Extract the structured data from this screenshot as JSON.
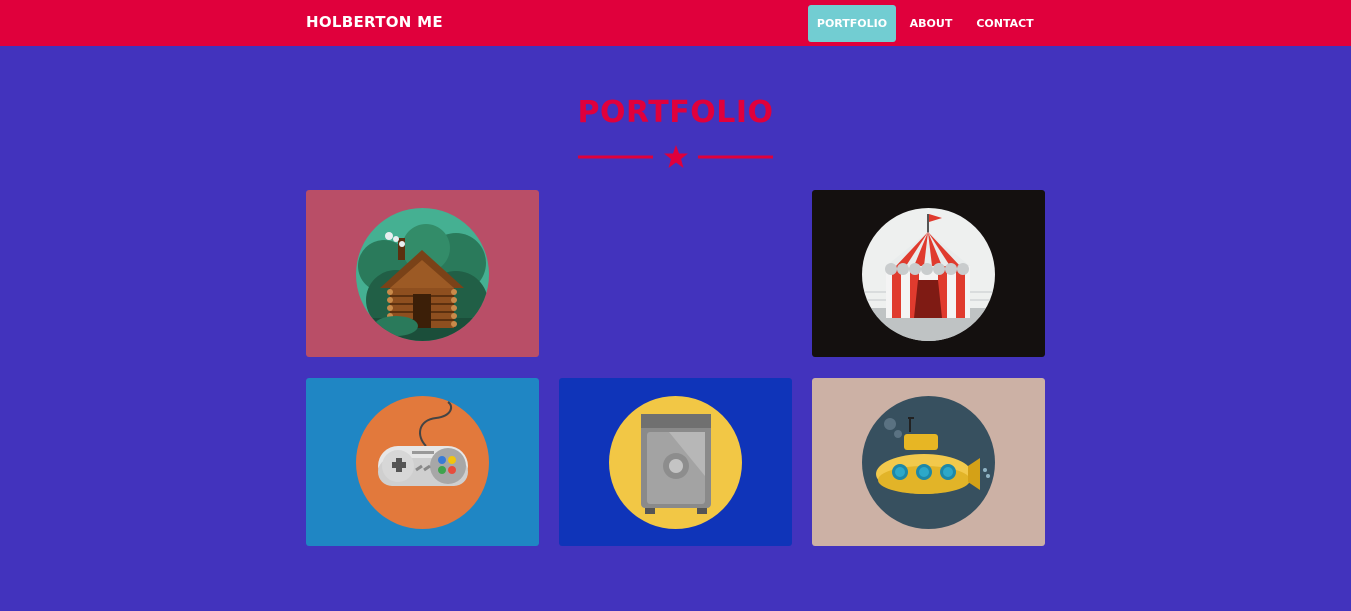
{
  "navbar": {
    "brand": "HOLBERTON ME",
    "items": [
      {
        "label": "PORTFOLIO",
        "active": true
      },
      {
        "label": "ABOUT",
        "active": false
      },
      {
        "label": "CONTACT",
        "active": false
      }
    ]
  },
  "section": {
    "title": "PORTFOLIO",
    "divider_icon": "star-icon"
  },
  "portfolio": {
    "items": [
      {
        "icon": "log-cabin-icon",
        "background": "#b94e67"
      },
      {
        "icon": "circus-tent-icon",
        "background": "#14100f"
      },
      {
        "icon": "game-controller-icon",
        "background": "#1f86c4"
      },
      {
        "icon": "safe-icon",
        "background": "#0f34b9"
      },
      {
        "icon": "submarine-icon",
        "background": "#ccb1a5"
      }
    ]
  },
  "colors": {
    "page_background": "#4233bd",
    "navbar": "#e0003c",
    "active_nav": "#72cdd2",
    "accent": "#e0003c"
  }
}
